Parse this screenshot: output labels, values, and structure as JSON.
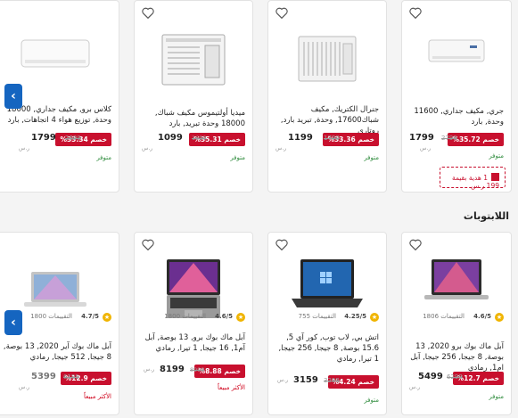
{
  "ac": [
    {
      "title": "جري, مكيف جداري, 11600 وحدة, بارد",
      "discount": "%35.72 خصم",
      "price": "1799",
      "old_price": "2799",
      "currency": "ر.س",
      "stock": "متوفر",
      "gift": "1 هدية بقيمة 199 ر.س"
    },
    {
      "title": "جنرال الكتريك, مكيف شباك17600, وحدة, تبريد بارد, روتاري",
      "discount": "%33.36 خصم",
      "price": "1199",
      "old_price": "1799",
      "currency": "ر.س",
      "stock": "متوفر"
    },
    {
      "title": "ميديا أولتيموس مكيف شباك, 18000 وحدة تبريد, بارد",
      "discount": "%35.31 خصم",
      "price": "1099",
      "old_price": "1699",
      "currency": "ر.س",
      "stock": "متوفر"
    },
    {
      "title": "كلاس برو, مكيف جداري, 18000 وحدة, توزيع هواء 4 اتجاهات, بارد",
      "discount": "%33.34 خصم",
      "price": "1799",
      "old_price": "2699",
      "currency": "ر.س",
      "stock": "متوفر"
    }
  ],
  "laptops_title": "اللابتوبات",
  "laptops": [
    {
      "rating": "4.6/5",
      "count": "1806 التقييمات",
      "title": "آبل ماك بوك برو 2020, 13 بوصة, 8 جيجا, 256 جيجا, آبل ام1, رمادي",
      "discount": "%12.7 خصم",
      "price": "5499",
      "old_price": "6299",
      "currency": "ر.س",
      "stock": "متوفر"
    },
    {
      "rating": "4.25/5",
      "count": "755 التقييمات",
      "title": "اتش بي, لاب توب, كور آي 5, 15.6 بوصة, 8 جيجا, 256 جيجا, 1 تيرا, رمادي",
      "discount": "%4.24 خصم",
      "price": "3159",
      "old_price": "3299",
      "currency": "ر.س",
      "stock": "متوفر"
    },
    {
      "rating": "4.6/5",
      "count": "1800 التقييمات",
      "title": "آبل ماك بوك برو, 13 بوصة, آبل آم1, 16 جيجا, 1 تيرا, رمادي",
      "discount": "%8.88 خصم",
      "price": "8199",
      "old_price": "8999",
      "currency": "ر.س",
      "stock": "الأكثر مبيعاً"
    },
    {
      "rating": "4.7/5",
      "count": "1800 التقييمات",
      "title": "آبل ماك بوك آير 2020, 13 بوصة, 8 جيجا, 512 جيجا, رمادي",
      "discount": "%12.9 خصم",
      "price": "5399",
      "old_price": "6199",
      "currency": "ر.س",
      "stock": "الأكثر مبيعاً"
    }
  ],
  "icons": {
    "heart": "heart-outline-icon",
    "arrow": "chevron-left-icon",
    "star": "star-icon",
    "gift": "gift-icon"
  },
  "colors": {
    "discount": "#c8102e",
    "in_stock": "#2e8b3c",
    "bestseller": "#d0021b",
    "arrow_bg": "#1565c0"
  }
}
